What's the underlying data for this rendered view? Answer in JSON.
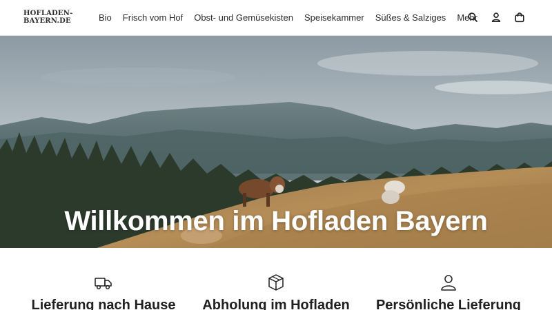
{
  "header": {
    "logo_line1": "HOFLADEN-",
    "logo_line2": "BAYERN.DE",
    "nav": [
      {
        "label": "Bio"
      },
      {
        "label": "Frisch vom Hof"
      },
      {
        "label": "Obst- und Gemüsekisten"
      },
      {
        "label": "Speisekammer"
      },
      {
        "label": "Süßes & Salziges"
      },
      {
        "label": "Mehr"
      }
    ],
    "icons": [
      "search-icon",
      "account-icon",
      "cart-icon"
    ]
  },
  "hero": {
    "title": "Willkommen im Hofladen Bayern"
  },
  "features": [
    {
      "icon": "truck-icon",
      "title": "Lieferung nach Hause"
    },
    {
      "icon": "box-icon",
      "title": "Abholung im Hofladen"
    },
    {
      "icon": "person-icon",
      "title": "Persönliche Lieferung"
    }
  ]
}
